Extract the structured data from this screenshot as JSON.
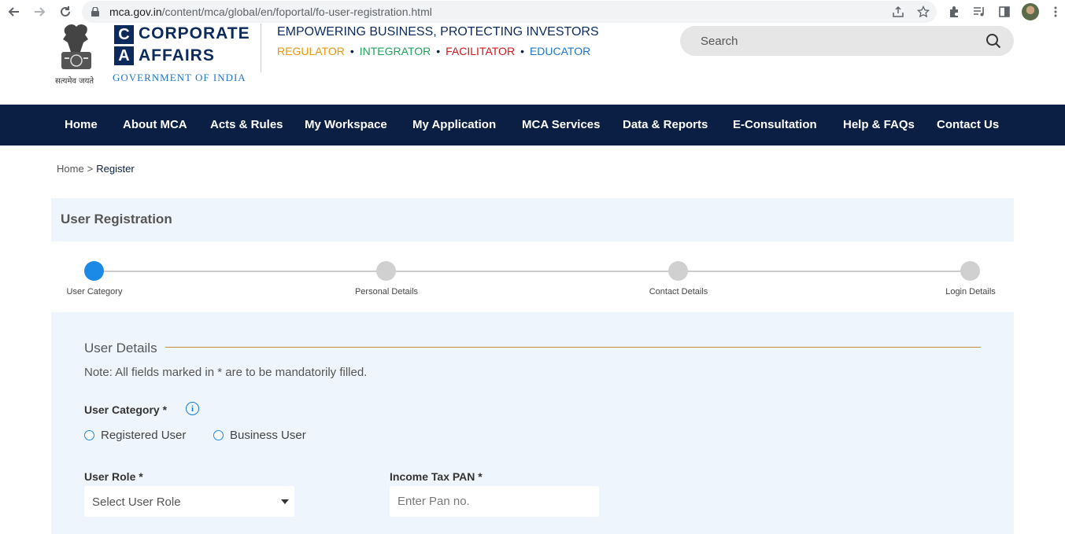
{
  "browser": {
    "url_host": "mca.gov.in",
    "url_path": "/content/mca/global/en/foportal/fo-user-registration.html"
  },
  "header": {
    "logo_letter_1": "C",
    "logo_word_1": "CORPORATE",
    "logo_letter_2": "A",
    "logo_word_2": "AFFAIRS",
    "government": "GOVERNMENT OF INDIA",
    "emblem_motto": "सत्यमेव जयते",
    "tagline": "EMPOWERING BUSINESS, PROTECTING INVESTORS",
    "roles": [
      {
        "label": "REGULATOR",
        "color": "#e8960c"
      },
      {
        "label": "INTEGRATOR",
        "color": "#1fa35a"
      },
      {
        "label": "FACILITATOR",
        "color": "#d4161d"
      },
      {
        "label": "EDUCATOR",
        "color": "#1f77c8"
      }
    ],
    "role_separator": "•",
    "search_placeholder": "Search"
  },
  "nav": {
    "items": [
      "Home",
      "About MCA",
      "Acts & Rules",
      "My Workspace",
      "My Application",
      "MCA Services",
      "Data & Reports",
      "E-Consultation",
      "Help & FAQs",
      "Contact Us"
    ]
  },
  "breadcrumb": {
    "home": "Home",
    "separator": ">",
    "current": "Register"
  },
  "page": {
    "title": "User Registration"
  },
  "stepper": {
    "steps": [
      "User Category",
      "Personal Details",
      "Contact Details",
      "Login Details"
    ],
    "active_index": 0
  },
  "form": {
    "section_title": "User Details",
    "note": "Note: All fields marked in * are to be mandatorily filled.",
    "user_category_label": "User Category *",
    "user_category_options": [
      "Registered User",
      "Business User"
    ],
    "user_role_label": "User Role *",
    "user_role_value": "Select User Role",
    "pan_label": "Income Tax PAN *",
    "pan_placeholder": "Enter Pan no."
  },
  "colors": {
    "nav_bg": "#0b1f45",
    "active_step": "#1a8ae6",
    "panel_bg": "#eef5fc",
    "section_rule": "#c48a3a"
  }
}
